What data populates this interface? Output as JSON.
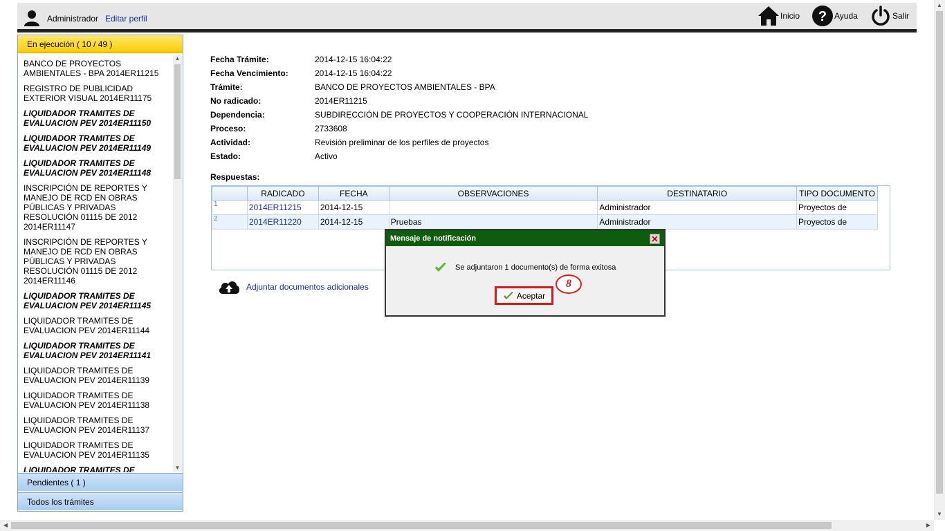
{
  "header": {
    "user_name": "Administrador",
    "edit_profile": "Editar perfil",
    "nav": [
      {
        "label": "Inicio",
        "icon": "home-icon"
      },
      {
        "label": "Ayuda",
        "icon": "help-icon"
      },
      {
        "label": "Salir",
        "icon": "power-icon"
      }
    ]
  },
  "sidebar": {
    "active_section": "En ejecución ( 10 / 49 )",
    "items": [
      {
        "text": "BANCO DE PROYECTOS AMBIENTALES - BPA 2014ER11215",
        "bold": false
      },
      {
        "text": "REGISTRO DE PUBLICIDAD EXTERIOR VISUAL 2014ER11175",
        "bold": false
      },
      {
        "text": "LIQUIDADOR TRAMITES DE EVALUACION PEV 2014ER11150",
        "bold": true
      },
      {
        "text": "LIQUIDADOR TRAMITES DE EVALUACION PEV 2014ER11149",
        "bold": true
      },
      {
        "text": "LIQUIDADOR TRAMITES DE EVALUACION PEV 2014ER11148",
        "bold": true
      },
      {
        "text": "INSCRIPCIÓN DE REPORTES Y MANEJO DE RCD EN OBRAS PÚBLICAS Y PRIVADAS RESOLUCIÓN 01115 DE 2012 2014ER11147",
        "bold": false
      },
      {
        "text": "INSCRIPCIÓN DE REPORTES Y MANEJO DE RCD EN OBRAS PÚBLICAS Y PRIVADAS RESOLUCIÓN 01115 DE 2012 2014ER11146",
        "bold": false
      },
      {
        "text": "LIQUIDADOR TRAMITES DE EVALUACION PEV 2014ER11145",
        "bold": true
      },
      {
        "text": "LIQUIDADOR TRAMITES DE EVALUACION PEV 2014ER11144",
        "bold": false
      },
      {
        "text": "LIQUIDADOR TRAMITES DE EVALUACION PEV 2014ER11141",
        "bold": true
      },
      {
        "text": "LIQUIDADOR TRAMITES DE EVALUACION PEV 2014ER11139",
        "bold": false
      },
      {
        "text": "LIQUIDADOR TRAMITES DE EVALUACION PEV 2014ER11138",
        "bold": false
      },
      {
        "text": "LIQUIDADOR TRAMITES DE EVALUACION PEV 2014ER11137",
        "bold": false
      },
      {
        "text": "LIQUIDADOR TRAMITES DE EVALUACION PEV 2014ER11135",
        "bold": false
      },
      {
        "text": "LIQUIDADOR TRAMITES DE",
        "bold": true
      }
    ],
    "pending_section": "Pendientes ( 1 )",
    "all_section": "Todos los trámites"
  },
  "details": {
    "fields": [
      {
        "label": "Fecha Trámite:",
        "value": "2014-12-15 16:04:22"
      },
      {
        "label": "Fecha Vencimiento:",
        "value": "2014-12-15 16:04:22"
      },
      {
        "label": "Trámite:",
        "value": "BANCO DE PROYECTOS AMBIENTALES - BPA"
      },
      {
        "label": "No radicado:",
        "value": "2014ER11215"
      },
      {
        "label": "Dependencia:",
        "value": "SUBDIRECCIÓN DE PROYECTOS Y COOPERACIÓN INTERNACIONAL"
      },
      {
        "label": "Proceso:",
        "value": "2733608"
      },
      {
        "label": "Actividad:",
        "value": "Revisión preliminar de los perfiles de proyectos"
      },
      {
        "label": "Estado:",
        "value": "Activo"
      }
    ],
    "responses_label": "Respuestas:"
  },
  "responses_table": {
    "columns": [
      "",
      "RADICADO",
      "FECHA",
      "OBSERVACIONES",
      "DESTINATARIO",
      "TIPO DOCUMENTO"
    ],
    "rows": [
      [
        "1",
        "2014ER11215",
        "2014-12-15",
        "",
        "Administrador",
        "Proyectos de"
      ],
      [
        "2",
        "2014ER11220",
        "2014-12-15",
        "Pruebas",
        "Administrador",
        "Proyectos de"
      ]
    ]
  },
  "upload": {
    "label": "Adjuntar documentos adicionales",
    "icon": "cloud-upload-icon"
  },
  "dialog": {
    "title": "Mensaje de notificación",
    "message": "Se adjuntaron 1 documento(s) de forma exitosa",
    "ok_label": "Aceptar",
    "annotation": "8",
    "title_color": "#0e5d0e",
    "highlight_color": "#e01818"
  }
}
